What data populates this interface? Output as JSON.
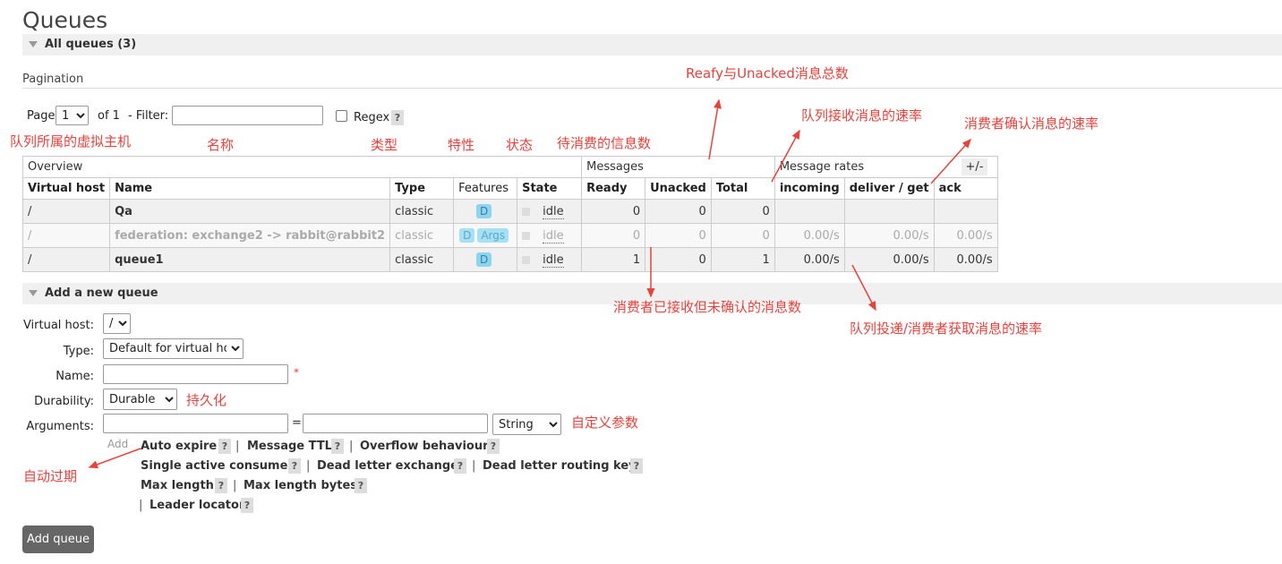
{
  "page_title": "Queues",
  "all_queues_header": "All queues (3)",
  "pagination": {
    "label": "Pagination",
    "page_label": "Page",
    "page_value": "1",
    "of_label": "of 1",
    "filter_label": "- Filter:",
    "filter_value": "",
    "regex_label": "Regex",
    "help": "?"
  },
  "table": {
    "groups": [
      "Overview",
      "Messages",
      "Message rates"
    ],
    "columns": [
      "Virtual host",
      "Name",
      "Type",
      "Features",
      "State",
      "Ready",
      "Unacked",
      "Total",
      "incoming",
      "deliver / get",
      "ack"
    ],
    "plusminus": "+/-",
    "rows": [
      {
        "vhost": "/",
        "name": "Qa",
        "type": "classic",
        "features": [
          "D"
        ],
        "state": "idle",
        "ready": "0",
        "unacked": "0",
        "total": "0",
        "incoming": "",
        "deliver": "",
        "ack": "",
        "dim": false
      },
      {
        "vhost": "/",
        "name": "federation: exchange2 -> rabbit@rabbit2",
        "type": "classic",
        "features": [
          "D",
          "Args"
        ],
        "state": "idle",
        "ready": "0",
        "unacked": "0",
        "total": "0",
        "incoming": "0.00/s",
        "deliver": "0.00/s",
        "ack": "0.00/s",
        "dim": true
      },
      {
        "vhost": "/",
        "name": "queue1",
        "type": "classic",
        "features": [
          "D"
        ],
        "state": "idle",
        "ready": "1",
        "unacked": "0",
        "total": "1",
        "incoming": "0.00/s",
        "deliver": "0.00/s",
        "ack": "0.00/s",
        "dim": false
      }
    ]
  },
  "add_queue": {
    "header": "Add a new queue",
    "virtual_host_label": "Virtual host:",
    "virtual_host_value": "/",
    "type_label": "Type:",
    "type_value": "Default for virtual host",
    "name_label": "Name:",
    "name_value": "",
    "required_mark": "*",
    "durability_label": "Durability:",
    "durability_value": "Durable",
    "arguments_label": "Arguments:",
    "arg_key": "",
    "arg_eq": "=",
    "arg_value": "",
    "arg_type": "String",
    "add_label": "Add",
    "arg_links": [
      "Auto expire",
      "Message TTL",
      "Overflow behaviour",
      "Single active consumer",
      "Dead letter exchange",
      "Dead letter routing key",
      "Max length",
      "Max length bytes",
      "Leader locator"
    ],
    "separator": "|",
    "button": "Add queue"
  },
  "annotations": {
    "vhost": "队列所属的虚拟主机",
    "name": "名称",
    "type": "类型",
    "features": "特性",
    "state": "状态",
    "ready": "待消费的信息数",
    "total": "Reafy与Unacked消息总数",
    "incoming": "队列接收消息的速率",
    "ack": "消费者确认消息的速率",
    "unacked": "消费者已接收但未确认的消息数",
    "deliver": "队列投递/消费者获取消息的速率",
    "durable": "持久化",
    "arguments": "自定义参数",
    "auto_expire": "自动过期"
  },
  "colors": {
    "annotation": "#e8423b",
    "badge": "#8dd4f0",
    "button": "#666666"
  }
}
